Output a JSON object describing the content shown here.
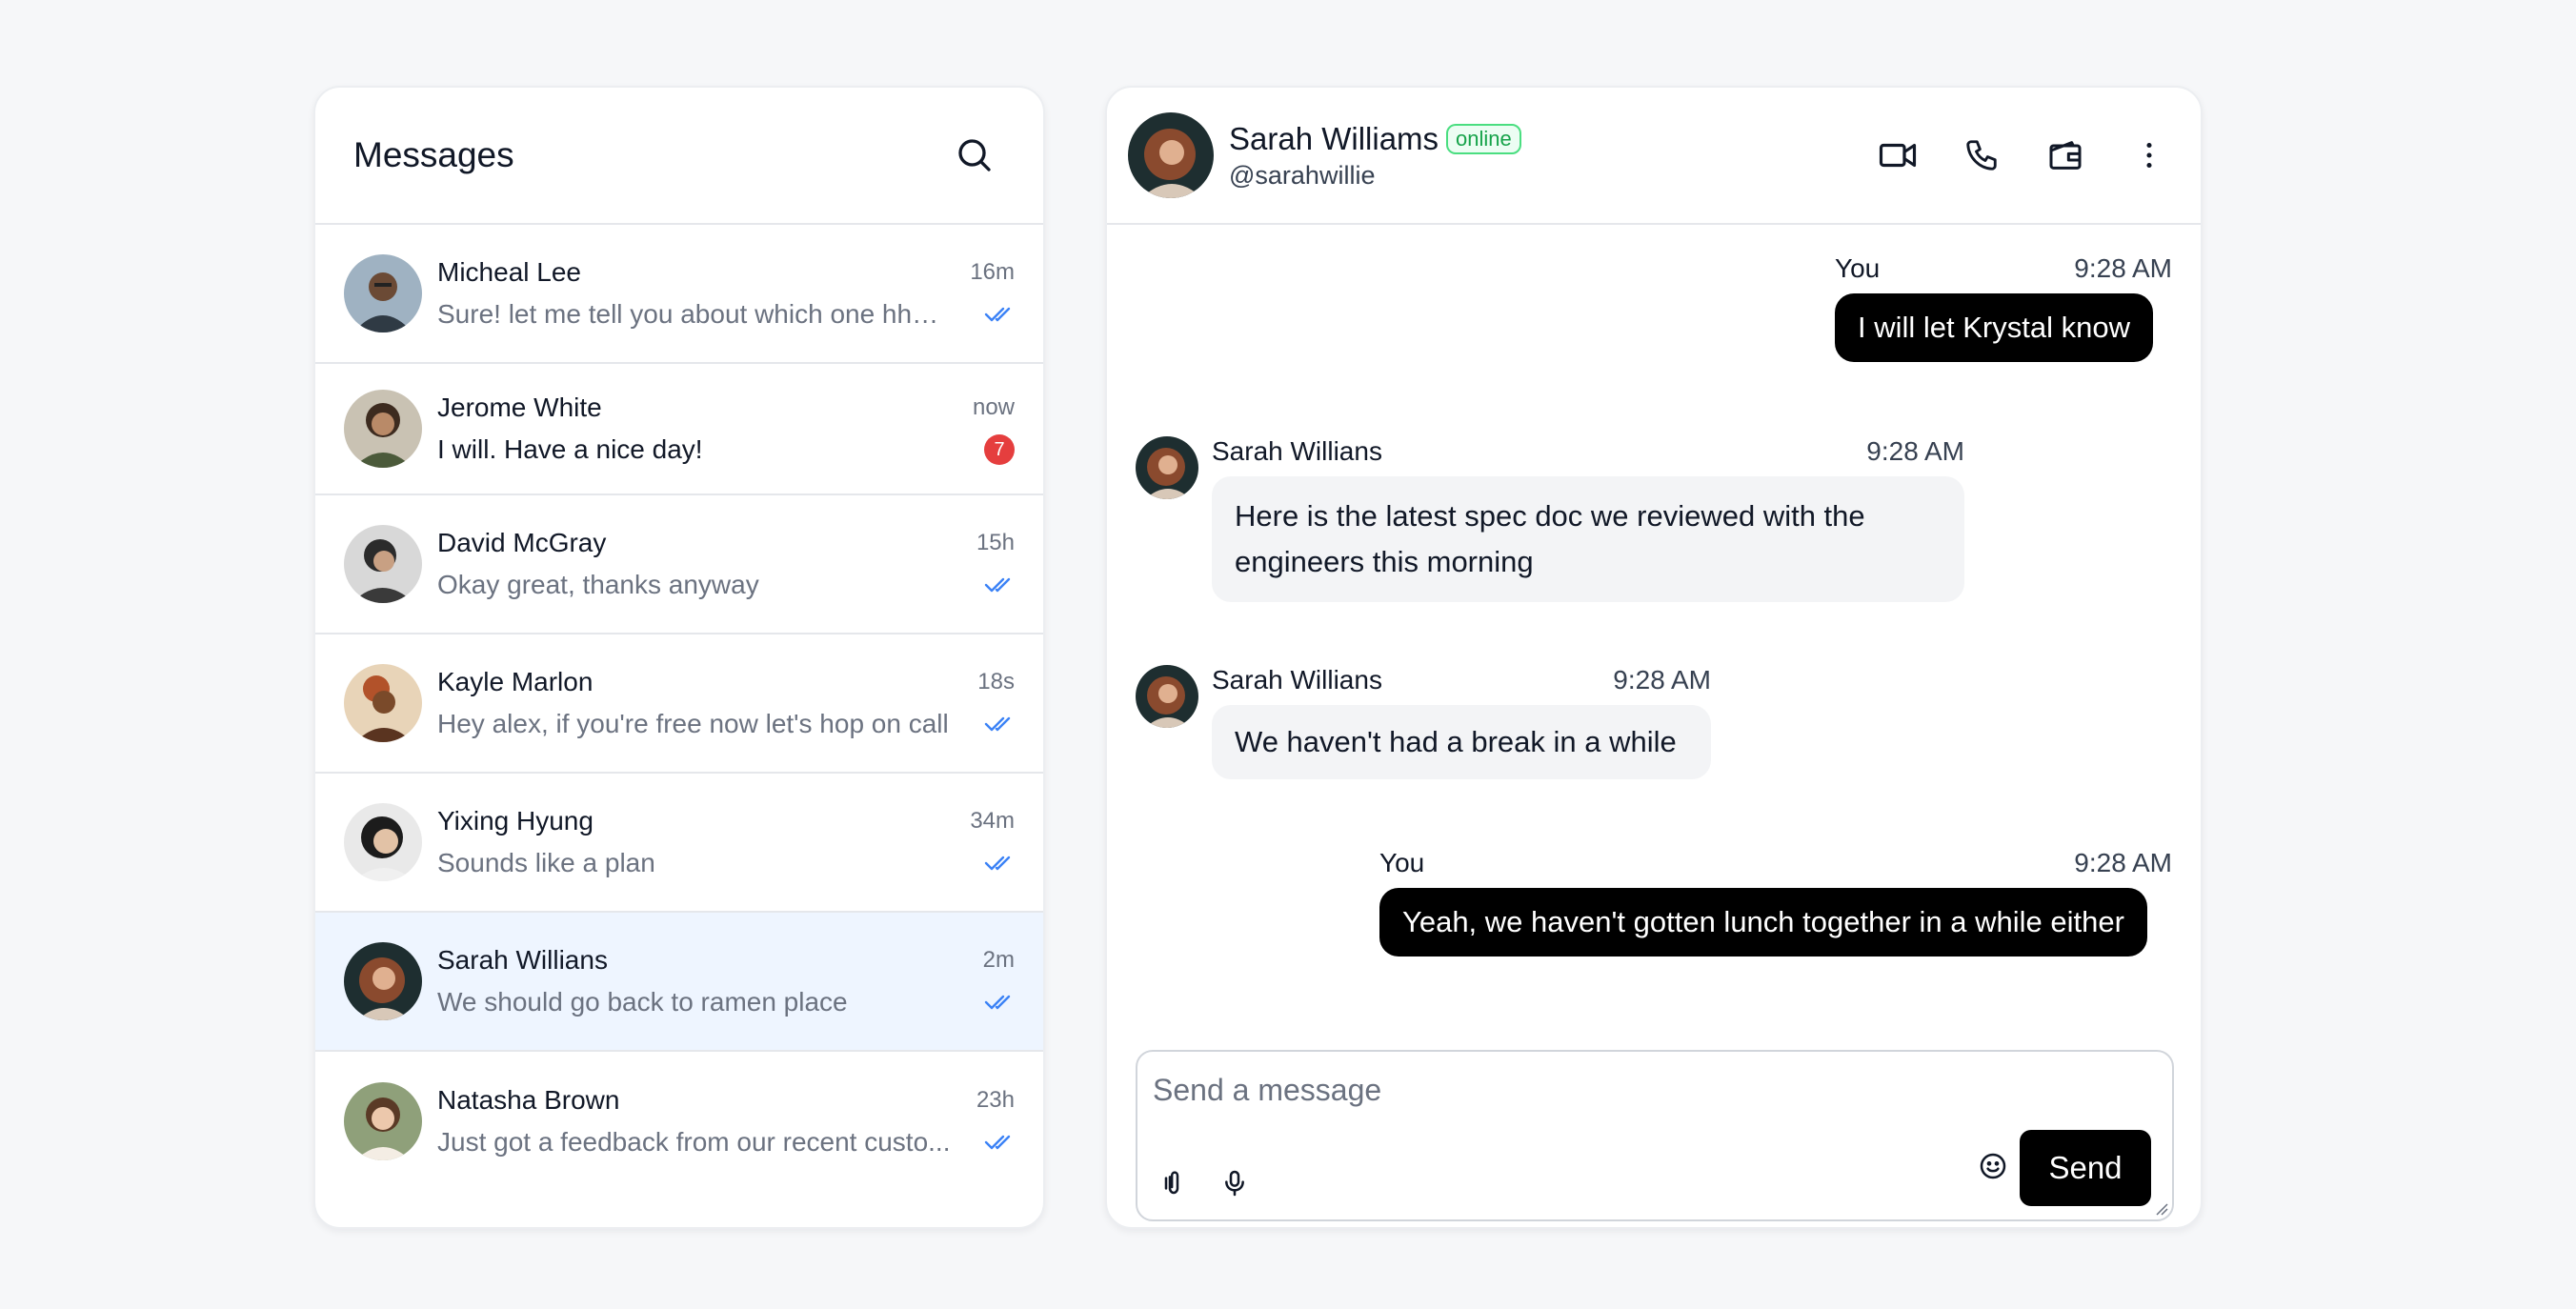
{
  "messages_list": {
    "title": "Messages",
    "search_icon": "search-icon",
    "conversations": [
      {
        "name": "Micheal Lee",
        "time": "16m",
        "preview": "Sure! let me tell you about which one hhs ...",
        "status": "read",
        "avatar_color": "#6b7f91"
      },
      {
        "name": "Jerome White",
        "time": "now",
        "preview": "I will. Have a nice day!",
        "unread_count": "7",
        "avatar_color": "#7b6a55"
      },
      {
        "name": "David McGray",
        "time": "15h",
        "preview": "Okay great, thanks anyway",
        "status": "read",
        "avatar_color": "#5a5a5a"
      },
      {
        "name": "Kayle Marlon",
        "time": "18s",
        "preview": "Hey alex, if you're free now let's hop on call",
        "status": "read",
        "avatar_color": "#c89a6a"
      },
      {
        "name": "Yixing Hyung",
        "time": "34m",
        "preview": "Sounds like a plan",
        "status": "read",
        "avatar_color": "#2e2e2e"
      },
      {
        "name": "Sarah Willians",
        "time": "2m",
        "preview": "We should go back to ramen place",
        "status": "read",
        "active": true,
        "avatar_color": "#8a4a2e"
      },
      {
        "name": "Natasha Brown",
        "time": "23h",
        "preview": "Just got a feedback from our recent custo...",
        "status": "read",
        "avatar_color": "#7a8a6a"
      }
    ]
  },
  "chat": {
    "contact_name": "Sarah Williams",
    "online_label": "online",
    "handle": "@sarahwillie",
    "actions": [
      "video-camera-icon",
      "phone-icon",
      "wallet-icon",
      "more-vertical-icon"
    ],
    "messages": [
      {
        "from": "You",
        "time": "9:28 AM",
        "text": "I will let Krystal know",
        "outgoing": true
      },
      {
        "from": "Sarah Willians",
        "time": "9:28 AM",
        "text": "Here is the latest spec doc we reviewed with the engineers this morning",
        "outgoing": false
      },
      {
        "from": "Sarah Willians",
        "time": "9:28 AM",
        "text": "We haven't had a break in a while",
        "outgoing": false
      },
      {
        "from": "You",
        "time": "9:28 AM",
        "text": "Yeah, we haven't gotten lunch together in a while either",
        "outgoing": true
      }
    ],
    "composer": {
      "placeholder": "Send a message",
      "value": "",
      "send_label": "Send"
    }
  },
  "colors": {
    "accent_blue": "#3b82f6",
    "active_row": "#eef5ff",
    "unread_badge": "#e53e3e",
    "online_green": "#16a34a",
    "outgoing_bubble": "#000000",
    "incoming_bubble": "#f3f4f6"
  }
}
